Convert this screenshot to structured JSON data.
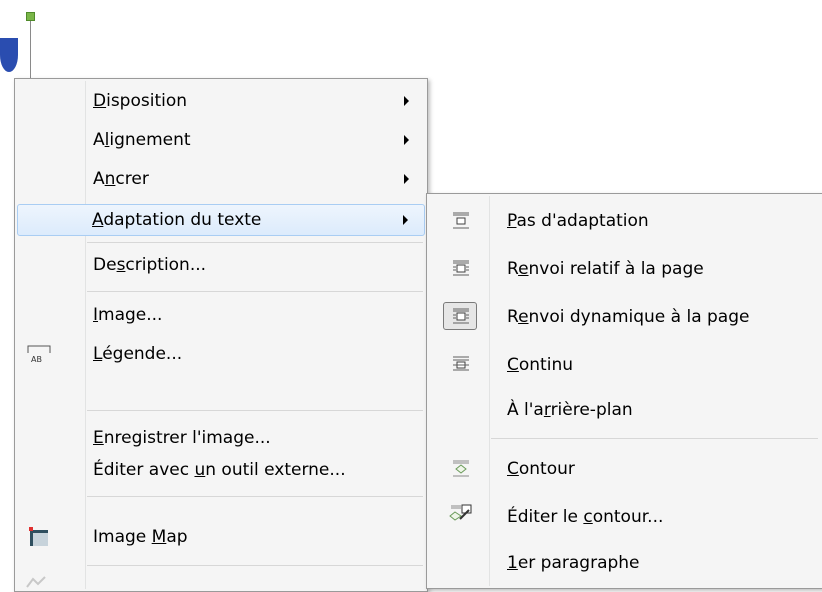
{
  "context_menu": {
    "items": [
      {
        "pre": "",
        "u": "D",
        "post": "isposition"
      },
      {
        "pre": "A",
        "u": "l",
        "post": "ignement"
      },
      {
        "pre": "A",
        "u": "n",
        "post": "crer"
      },
      {
        "pre": "",
        "u": "A",
        "post": "daptation du texte"
      },
      {
        "pre": "De",
        "u": "s",
        "post": "cription..."
      },
      {
        "pre": "",
        "u": "I",
        "post": "mage..."
      },
      {
        "pre": "",
        "u": "L",
        "post": "égende..."
      },
      {
        "pre": "",
        "u": "E",
        "post": "nregistrer l'image..."
      },
      {
        "pre": "Éditer avec ",
        "u": "u",
        "post": "n outil externe..."
      },
      {
        "pre": "Image ",
        "u": "M",
        "post": "ap"
      }
    ]
  },
  "submenu": {
    "title": "Adaptation du texte",
    "items": [
      {
        "pre": "",
        "u": "P",
        "post": "as d'adaptation"
      },
      {
        "pre": "R",
        "u": "e",
        "post": "nvoi relatif à la page"
      },
      {
        "pre": "R",
        "u": "e",
        "post": "nvoi dynamique à la page"
      },
      {
        "pre": "",
        "u": "C",
        "post": "ontinu"
      },
      {
        "pre": "À l'a",
        "u": "r",
        "post": "rière-plan"
      },
      {
        "pre": "",
        "u": "C",
        "post": "ontour"
      },
      {
        "pre": "Éditer le ",
        "u": "c",
        "post": "ontour..."
      },
      {
        "pre": "",
        "u": "1",
        "post": "er paragraphe"
      }
    ],
    "checked_index": 2
  },
  "icons": {
    "caption_icon_text": "AB"
  }
}
